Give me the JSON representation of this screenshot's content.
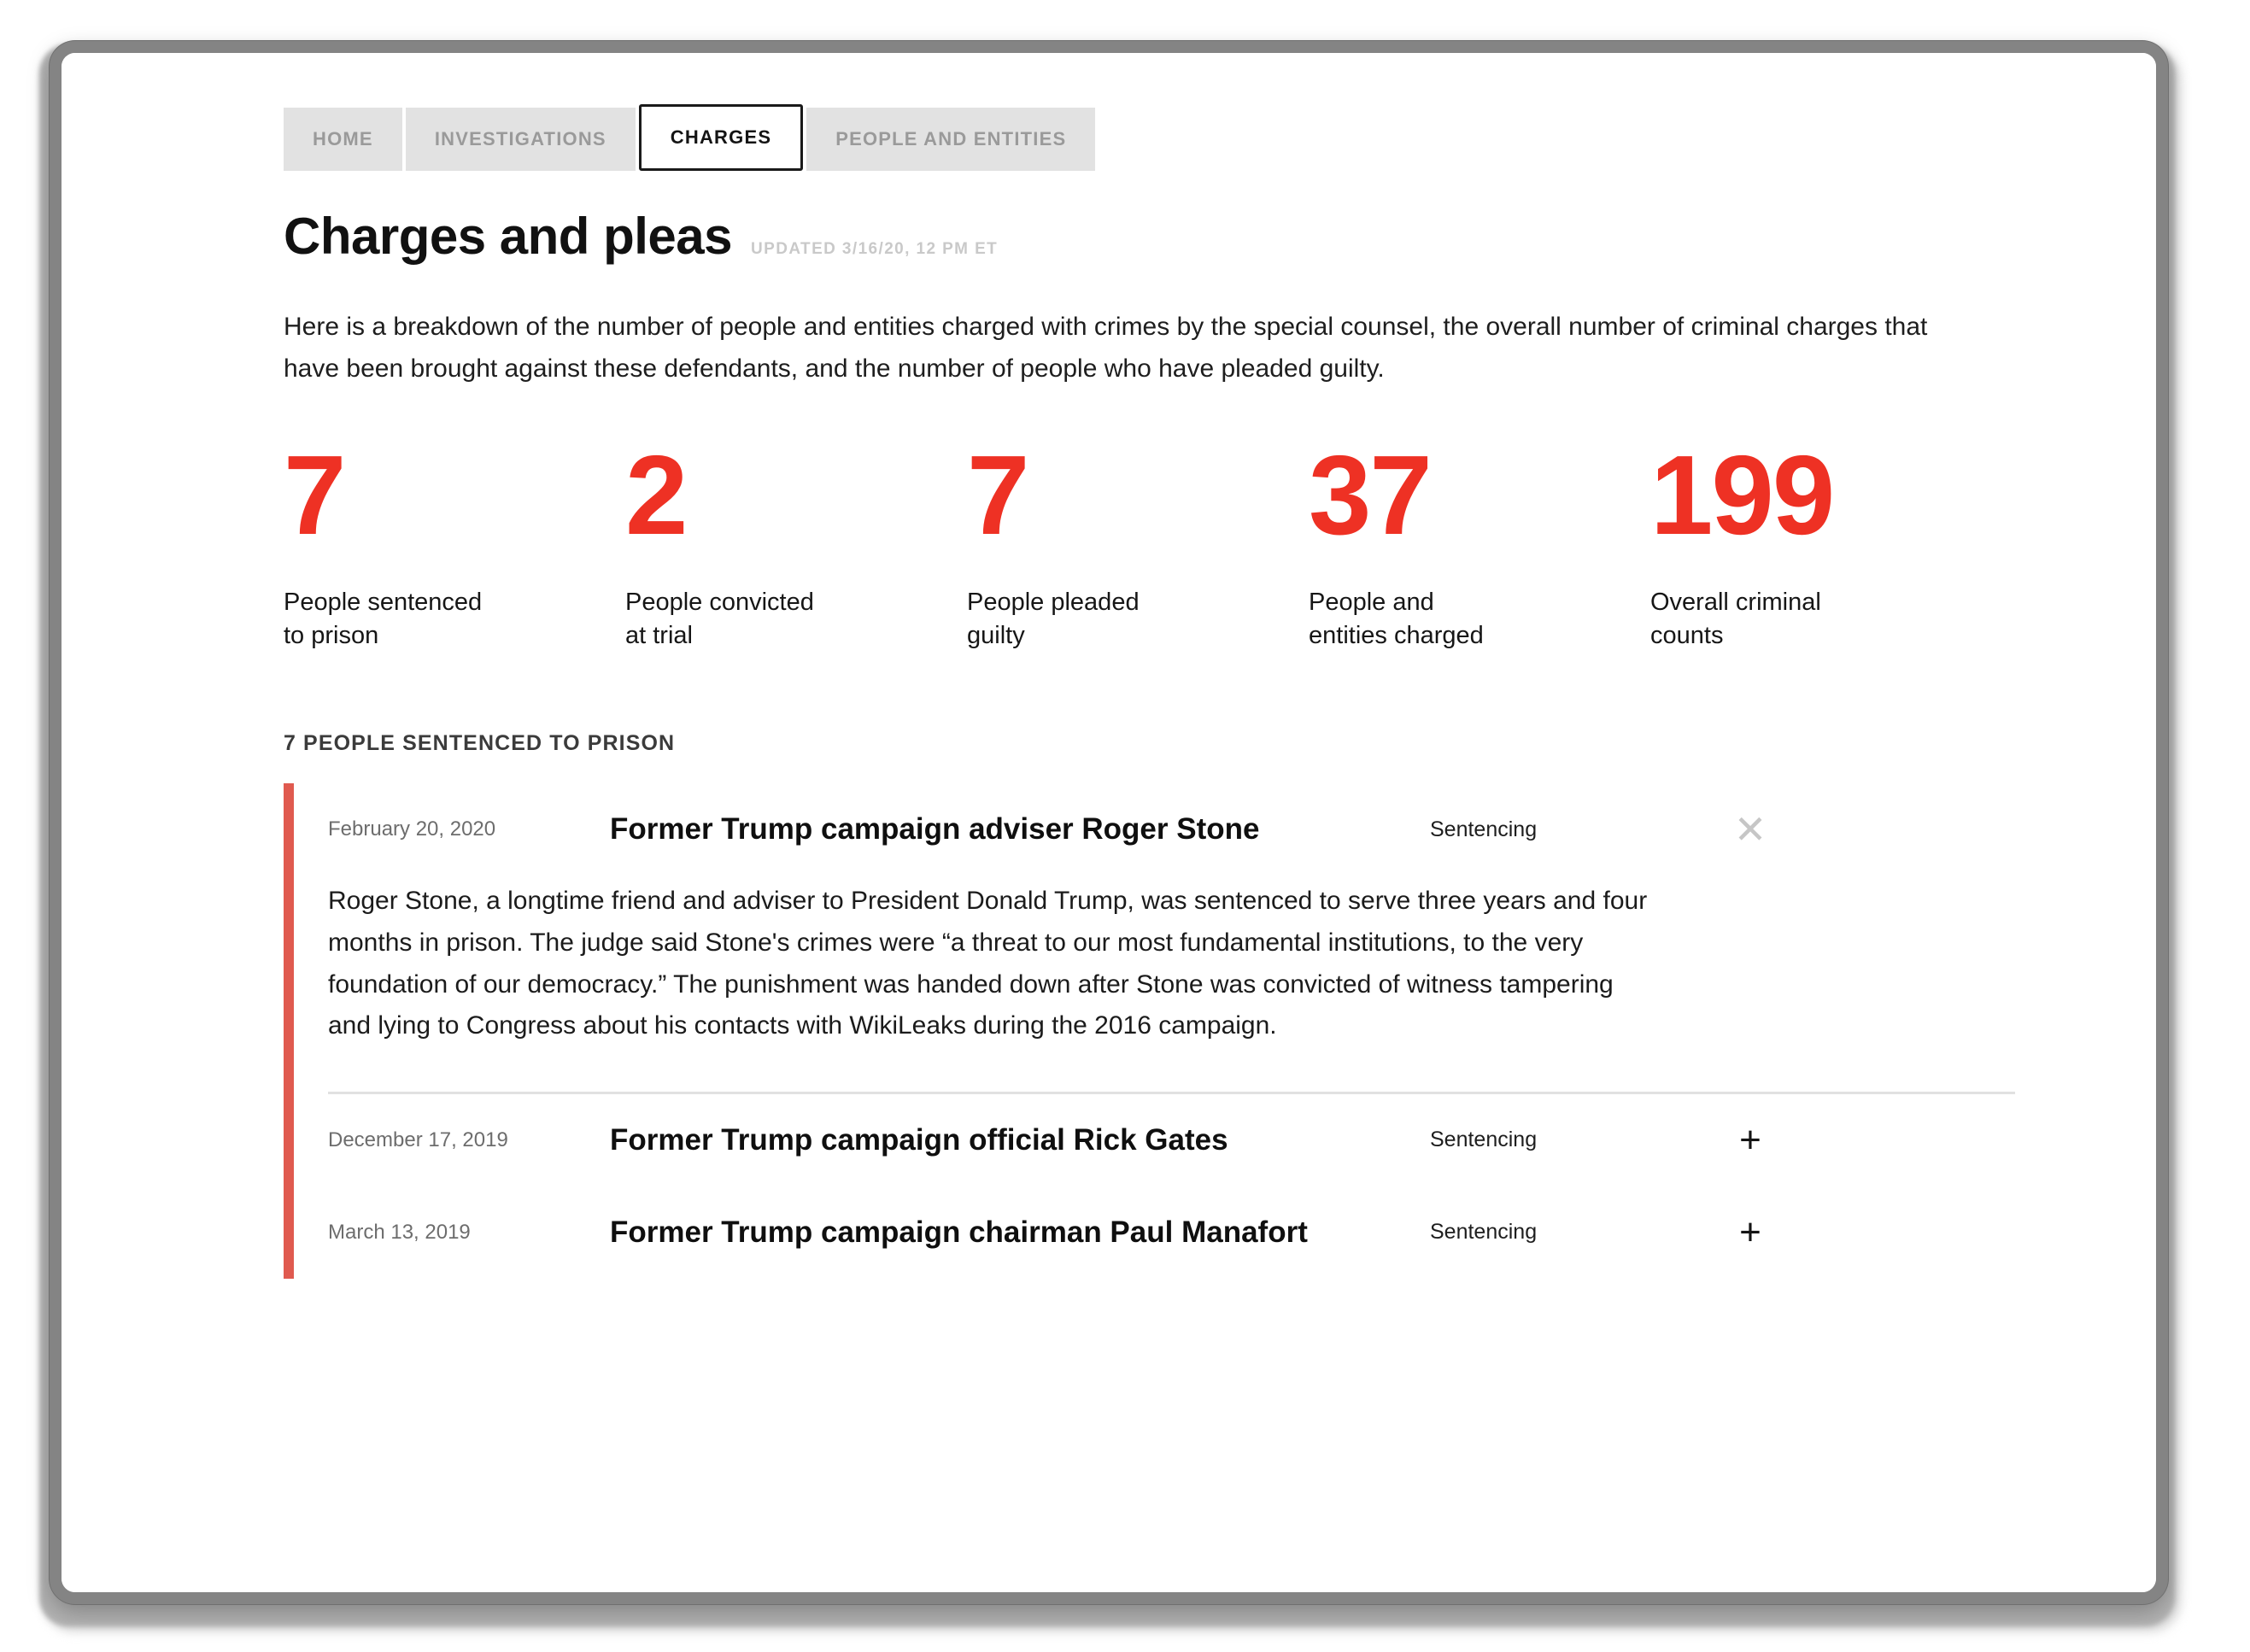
{
  "nav": {
    "tabs": [
      {
        "label": "HOME",
        "active": false
      },
      {
        "label": "INVESTIGATIONS",
        "active": false
      },
      {
        "label": "CHARGES",
        "active": true
      },
      {
        "label": "PEOPLE AND ENTITIES",
        "active": false
      }
    ]
  },
  "header": {
    "title": "Charges and pleas",
    "updated": "UPDATED 3/16/20, 12 PM ET"
  },
  "intro": "Here is a breakdown of the number of people and entities charged with crimes by the special counsel, the overall number of criminal charges that have been brought against these defendants, and the number of people who have pleaded guilty.",
  "stats": [
    {
      "value": "7",
      "label": "People sentenced\nto prison"
    },
    {
      "value": "2",
      "label": "People convicted\nat trial"
    },
    {
      "value": "7",
      "label": "People pleaded\nguilty"
    },
    {
      "value": "37",
      "label": "People and\nentities charged"
    },
    {
      "value": "199",
      "label": "Overall criminal\ncounts"
    }
  ],
  "section": {
    "heading": "7 PEOPLE SENTENCED TO PRISON",
    "accent_color": "#e05a4f",
    "entries": [
      {
        "date": "February 20, 2020",
        "title": "Former Trump campaign adviser Roger Stone",
        "type": "Sentencing",
        "expanded": true,
        "toggle": "✕",
        "body": "Roger Stone, a longtime friend and adviser to President Donald Trump, was sentenced to serve three years and four months in prison. The judge said Stone's crimes were “a threat to our most fundamental institutions, to the very foundation of our democracy.” The punishment was handed down after Stone was convicted of witness tampering and lying to Congress about his contacts with WikiLeaks during the 2016 campaign."
      },
      {
        "date": "December 17, 2019",
        "title": "Former Trump campaign official Rick Gates",
        "type": "Sentencing",
        "expanded": false,
        "toggle": "+",
        "body": ""
      },
      {
        "date": "March 13, 2019",
        "title": "Former Trump campaign chairman Paul Manafort",
        "type": "Sentencing",
        "expanded": false,
        "toggle": "+",
        "body": ""
      }
    ]
  },
  "colors": {
    "accent_red": "#ee3124",
    "bar_red": "#e05a4f",
    "tab_inactive_bg": "#e2e2e2",
    "frame_gray": "#848484"
  }
}
